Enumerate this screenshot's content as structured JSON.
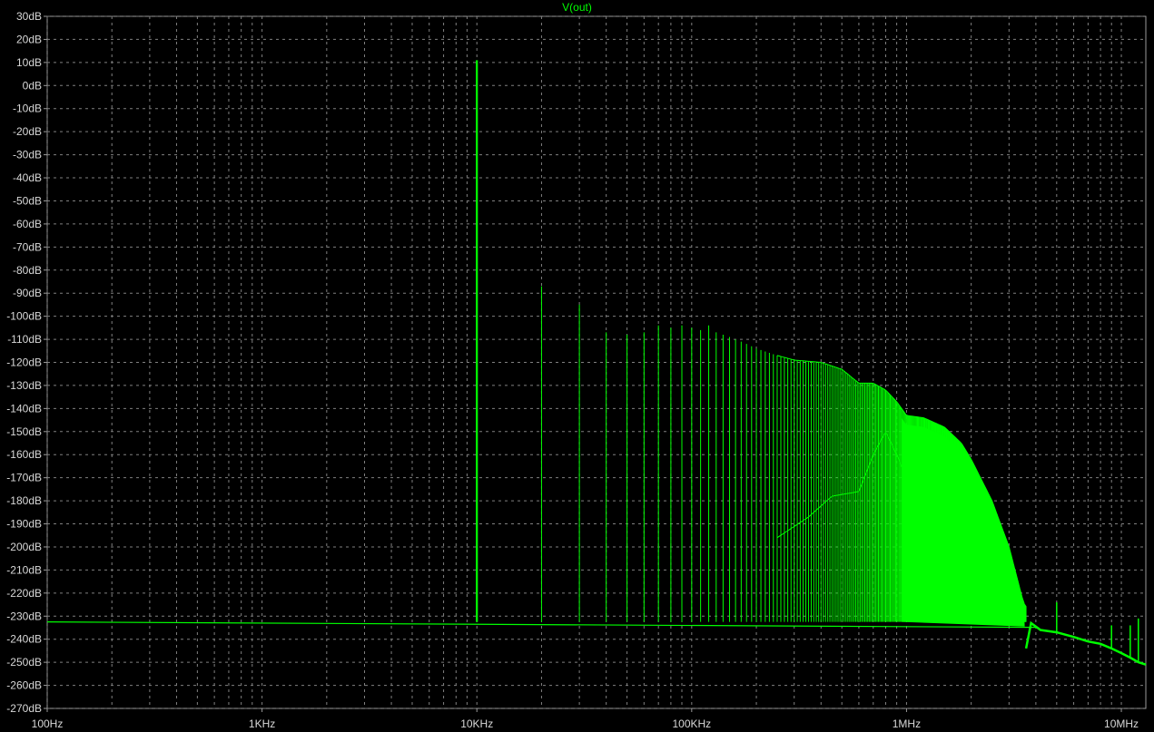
{
  "chart_data": {
    "type": "line",
    "title": "V(out)",
    "xlabel": "",
    "ylabel": "",
    "xscale": "log",
    "xlim": [
      100,
      13000000
    ],
    "ylim": [
      -270,
      30
    ],
    "grid": true,
    "x_ticks": [
      {
        "value": 100,
        "label": "100Hz"
      },
      {
        "value": 1000,
        "label": "1KHz"
      },
      {
        "value": 10000,
        "label": "10KHz"
      },
      {
        "value": 100000,
        "label": "100KHz"
      },
      {
        "value": 1000000,
        "label": "1MHz"
      },
      {
        "value": 10000000,
        "label": "10MHz"
      }
    ],
    "y_ticks": [
      {
        "value": 30,
        "label": "30dB"
      },
      {
        "value": 20,
        "label": "20dB"
      },
      {
        "value": 10,
        "label": "10dB"
      },
      {
        "value": 0,
        "label": "0dB"
      },
      {
        "value": -10,
        "label": "-10dB"
      },
      {
        "value": -20,
        "label": "-20dB"
      },
      {
        "value": -30,
        "label": "-30dB"
      },
      {
        "value": -40,
        "label": "-40dB"
      },
      {
        "value": -50,
        "label": "-50dB"
      },
      {
        "value": -60,
        "label": "-60dB"
      },
      {
        "value": -70,
        "label": "-70dB"
      },
      {
        "value": -80,
        "label": "-80dB"
      },
      {
        "value": -90,
        "label": "-90dB"
      },
      {
        "value": -100,
        "label": "-100dB"
      },
      {
        "value": -110,
        "label": "-110dB"
      },
      {
        "value": -120,
        "label": "-120dB"
      },
      {
        "value": -130,
        "label": "-130dB"
      },
      {
        "value": -140,
        "label": "-140dB"
      },
      {
        "value": -150,
        "label": "-150dB"
      },
      {
        "value": -160,
        "label": "-160dB"
      },
      {
        "value": -170,
        "label": "-170dB"
      },
      {
        "value": -180,
        "label": "-180dB"
      },
      {
        "value": -190,
        "label": "-190dB"
      },
      {
        "value": -200,
        "label": "-200dB"
      },
      {
        "value": -210,
        "label": "-210dB"
      },
      {
        "value": -220,
        "label": "-220dB"
      },
      {
        "value": -230,
        "label": "-230dB"
      },
      {
        "value": -240,
        "label": "-240dB"
      },
      {
        "value": -250,
        "label": "-250dB"
      },
      {
        "value": -260,
        "label": "-260dB"
      },
      {
        "value": -270,
        "label": "-270dB"
      }
    ],
    "series": [
      {
        "name": "V(out)",
        "color": "#00ff00",
        "noise_floor_db": -232.5,
        "fundamental_hz": 10000,
        "harmonic_peaks_db": [
          [
            10000,
            11
          ],
          [
            20000,
            -87
          ],
          [
            30000,
            -95
          ],
          [
            40000,
            -107
          ],
          [
            50000,
            -108
          ],
          [
            60000,
            -107
          ],
          [
            70000,
            -104
          ],
          [
            80000,
            -105
          ],
          [
            90000,
            -104
          ],
          [
            100000,
            -105
          ],
          [
            110000,
            -106
          ],
          [
            120000,
            -104
          ],
          [
            130000,
            -107
          ],
          [
            140000,
            -108
          ],
          [
            150000,
            -109
          ],
          [
            160000,
            -110
          ],
          [
            170000,
            -111
          ],
          [
            180000,
            -112
          ],
          [
            200000,
            -114
          ],
          [
            250000,
            -117
          ],
          [
            300000,
            -119
          ],
          [
            400000,
            -120
          ],
          [
            500000,
            -123
          ],
          [
            600000,
            -129
          ],
          [
            700000,
            -129
          ],
          [
            800000,
            -132
          ],
          [
            900000,
            -137
          ],
          [
            1000000,
            -143
          ],
          [
            1200000,
            -144
          ],
          [
            1500000,
            -148
          ],
          [
            1800000,
            -155
          ],
          [
            2000000,
            -162
          ],
          [
            2500000,
            -180
          ],
          [
            3000000,
            -200
          ],
          [
            3500000,
            -224
          ],
          [
            4000000,
            -232
          ]
        ],
        "envelope_low_db": [
          [
            250000,
            -196
          ],
          [
            350000,
            -187
          ],
          [
            450000,
            -178
          ],
          [
            600000,
            -176
          ],
          [
            700000,
            -160
          ],
          [
            800000,
            -150
          ],
          [
            900000,
            -160
          ],
          [
            1000000,
            -170
          ],
          [
            1500000,
            -200
          ],
          [
            2000000,
            -215
          ],
          [
            3000000,
            -228
          ]
        ],
        "tail_points_db": [
          [
            3600000,
            -244
          ],
          [
            3800000,
            -233
          ],
          [
            4200000,
            -236
          ],
          [
            5000000,
            -237
          ],
          [
            6000000,
            -239
          ],
          [
            7000000,
            -241
          ],
          [
            8000000,
            -242
          ],
          [
            9000000,
            -244
          ],
          [
            10000000,
            -246
          ],
          [
            11000000,
            -248
          ],
          [
            12000000,
            -250
          ],
          [
            13000000,
            -251
          ]
        ],
        "tail_spikes_db": [
          [
            5000000,
            -224
          ],
          [
            9000000,
            -234
          ],
          [
            11000000,
            -234
          ],
          [
            12000000,
            -231
          ]
        ]
      }
    ]
  }
}
